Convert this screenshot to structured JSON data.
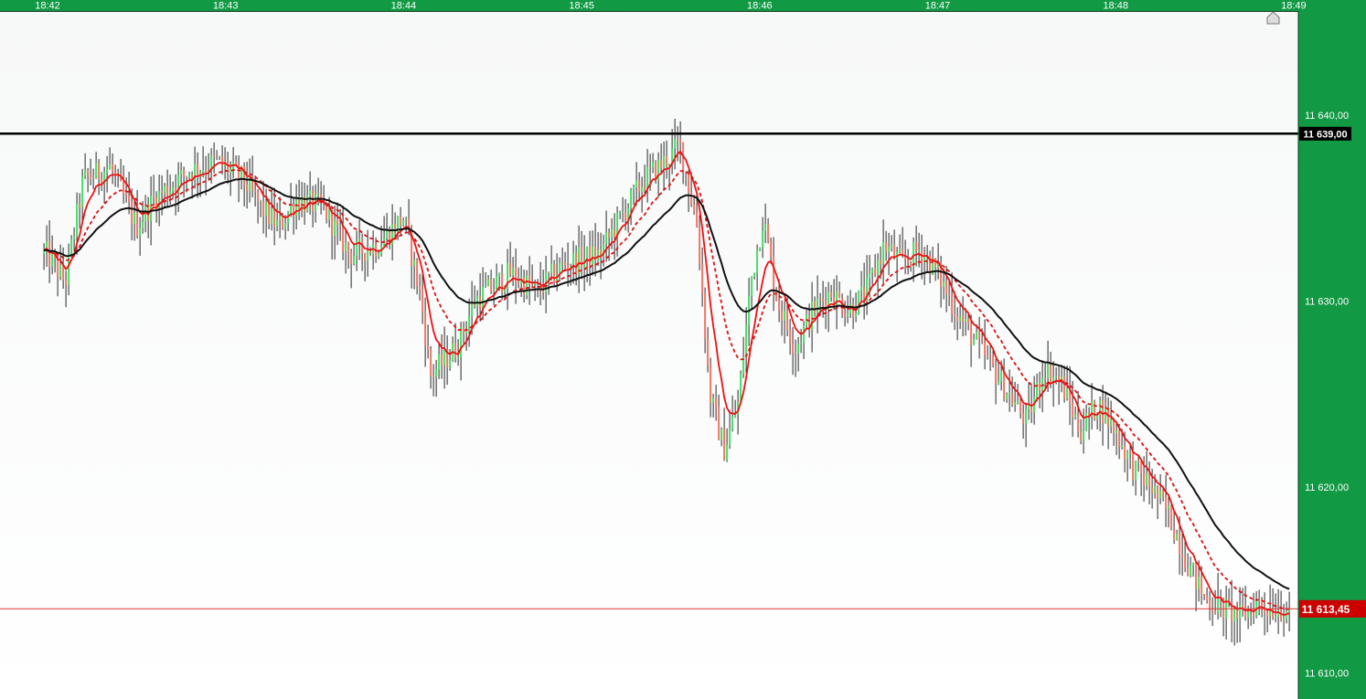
{
  "chart_data": {
    "type": "candlestick",
    "time_labels": [
      "18:42",
      "18:43",
      "18:44",
      "18:45",
      "18:46",
      "18:47",
      "18:48",
      "18:49"
    ],
    "price_labels": [
      "11 640,00",
      "11 630,00",
      "11 620,00",
      "11 610,00"
    ],
    "price_ticks": [
      11640,
      11630,
      11620,
      11610
    ],
    "ylim": [
      11608.6,
      11645.6
    ],
    "xlim_minutes": [
      -0.02,
      6.99
    ],
    "level_line": {
      "label": "11 639,00",
      "value": 11639
    },
    "current_price": {
      "label": "11 613,45",
      "value": 11613.45
    },
    "price_waypoints": [
      [
        0.0,
        11632.5
      ],
      [
        0.1,
        11631.0
      ],
      [
        0.2,
        11636.5
      ],
      [
        0.35,
        11637.2
      ],
      [
        0.5,
        11634.0
      ],
      [
        0.6,
        11635.5
      ],
      [
        0.8,
        11637.0
      ],
      [
        0.95,
        11637.5
      ],
      [
        1.1,
        11636.5
      ],
      [
        1.2,
        11635.0
      ],
      [
        1.3,
        11634.0
      ],
      [
        1.4,
        11635.5
      ],
      [
        1.55,
        11635.0
      ],
      [
        1.7,
        11632.5
      ],
      [
        1.85,
        11633.0
      ],
      [
        2.0,
        11634.5
      ],
      [
        2.1,
        11630.0
      ],
      [
        2.15,
        11626.0
      ],
      [
        2.3,
        11627.5
      ],
      [
        2.4,
        11630.0
      ],
      [
        2.6,
        11631.5
      ],
      [
        2.75,
        11630.5
      ],
      [
        2.9,
        11632.0
      ],
      [
        3.1,
        11632.5
      ],
      [
        3.25,
        11635.0
      ],
      [
        3.35,
        11636.5
      ],
      [
        3.5,
        11637.8
      ],
      [
        3.55,
        11638.5
      ],
      [
        3.65,
        11634.0
      ],
      [
        3.72,
        11625.0
      ],
      [
        3.8,
        11622.0
      ],
      [
        3.88,
        11624.5
      ],
      [
        3.95,
        11631.0
      ],
      [
        4.02,
        11634.5
      ],
      [
        4.1,
        11630.0
      ],
      [
        4.2,
        11627.5
      ],
      [
        4.3,
        11629.5
      ],
      [
        4.4,
        11630.5
      ],
      [
        4.5,
        11629.5
      ],
      [
        4.6,
        11630.5
      ],
      [
        4.7,
        11633.0
      ],
      [
        4.8,
        11632.0
      ],
      [
        4.9,
        11632.8
      ],
      [
        5.0,
        11631.5
      ],
      [
        5.1,
        11629.5
      ],
      [
        5.2,
        11628.0
      ],
      [
        5.3,
        11626.5
      ],
      [
        5.4,
        11625.0
      ],
      [
        5.5,
        11623.5
      ],
      [
        5.6,
        11626.5
      ],
      [
        5.7,
        11625.5
      ],
      [
        5.8,
        11623.0
      ],
      [
        5.9,
        11624.5
      ],
      [
        6.0,
        11623.0
      ],
      [
        6.1,
        11621.0
      ],
      [
        6.2,
        11620.0
      ],
      [
        6.3,
        11618.5
      ],
      [
        6.4,
        11616.0
      ],
      [
        6.5,
        11614.0
      ],
      [
        6.6,
        11613.5
      ],
      [
        6.7,
        11613.0
      ],
      [
        6.8,
        11613.8
      ],
      [
        6.85,
        11613.5
      ],
      [
        6.96,
        11613.45
      ]
    ],
    "colors": {
      "up": "#44dd66",
      "down": "#ee7766",
      "wick": "#111111",
      "fast_ma": "#ee1111",
      "medium_ma": "#dd1111",
      "slow_ma": "#111111",
      "level": "#000000",
      "price_line": "#dd3333",
      "price_tag": "#cc0000",
      "axis_bg": "#119944"
    },
    "series": [
      {
        "type": "moving-average",
        "style": "solid",
        "period": 8
      },
      {
        "type": "moving-average",
        "style": "dashed",
        "period": 20
      },
      {
        "type": "moving-average",
        "style": "solid",
        "period": 40
      }
    ]
  }
}
